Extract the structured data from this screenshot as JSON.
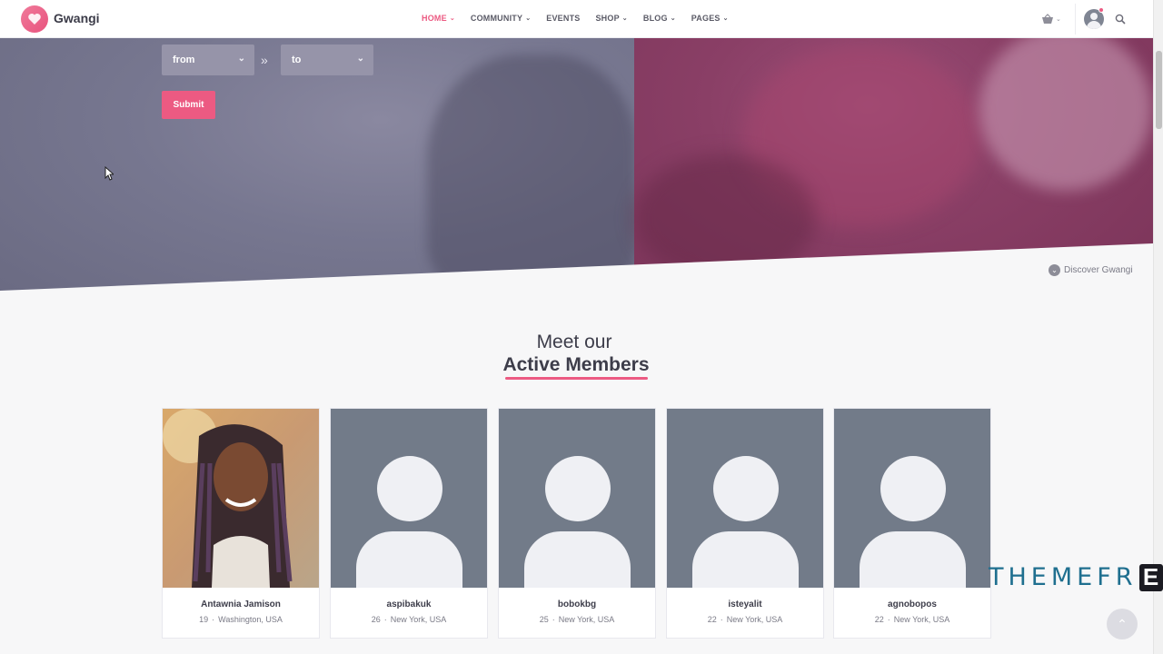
{
  "nav": {
    "brand": "Gwangi",
    "menu": [
      {
        "label": "HOME",
        "dropdown": true,
        "active": true
      },
      {
        "label": "COMMUNITY",
        "dropdown": true,
        "active": false
      },
      {
        "label": "EVENTS",
        "dropdown": false,
        "active": false
      },
      {
        "label": "SHOP",
        "dropdown": true,
        "active": false
      },
      {
        "label": "BLOG",
        "dropdown": true,
        "active": false
      },
      {
        "label": "PAGES",
        "dropdown": true,
        "active": false
      }
    ],
    "icons": [
      "cart-icon",
      "user-avatar-icon",
      "search-icon"
    ]
  },
  "search_form": {
    "from_label": "from",
    "to_label": "to",
    "submit_label": "Submit"
  },
  "hero": {
    "discover_label": "Discover Gwangi"
  },
  "members": {
    "subtitle": "Meet our",
    "title": "Active Members",
    "cards": [
      {
        "name": "Antawnia Jamison",
        "age": "19",
        "location": "Washington, USA",
        "has_photo": true
      },
      {
        "name": "aspibakuk",
        "age": "26",
        "location": "New York, USA",
        "has_photo": false
      },
      {
        "name": "bobokbg",
        "age": "25",
        "location": "New York, USA",
        "has_photo": false
      },
      {
        "name": "isteyalit",
        "age": "22",
        "location": "New York, USA",
        "has_photo": false
      },
      {
        "name": "agnobopos",
        "age": "22",
        "location": "New York, USA",
        "has_photo": false
      }
    ]
  },
  "watermark": {
    "text": "THEMEFR",
    "last_letter": "E"
  },
  "colors": {
    "accent": "#ec5a82",
    "text_dark": "#3d3d4a",
    "placeholder_avatar_bg": "#727b89"
  }
}
